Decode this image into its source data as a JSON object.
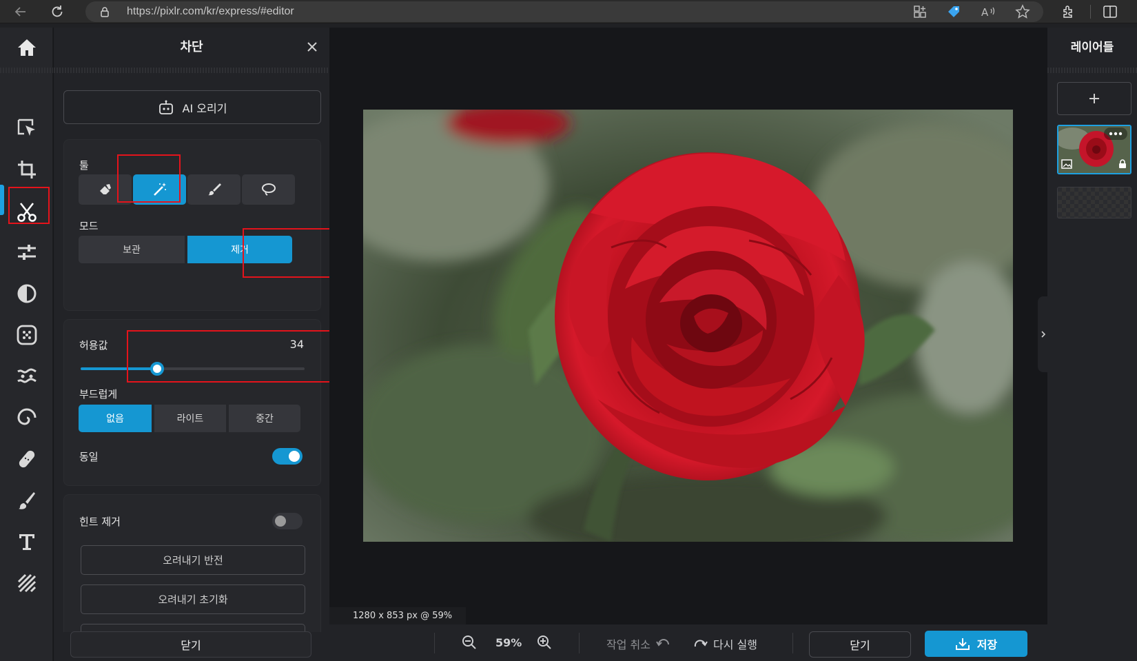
{
  "browser": {
    "url": "https://pixlr.com/kr/express/#editor"
  },
  "panel": {
    "title": "차단",
    "ai_button_label": "AI 오리기",
    "tools_label": "툴",
    "mode_label": "모드",
    "mode_options": [
      "보관",
      "제거"
    ],
    "mode_selected": "제거",
    "tolerance_label": "허용값",
    "tolerance_value": "34",
    "tolerance_fraction": 0.34,
    "smooth_label": "부드럽게",
    "smooth_options": [
      "없음",
      "라이트",
      "중간"
    ],
    "smooth_selected": "없음",
    "contiguous_label": "동일",
    "contiguous_on": true,
    "hint_label": "힌트 제거",
    "hint_on": false,
    "invert_button": "오려내기 반전",
    "reset_button": "오려내기 초기화",
    "close_button": "닫기"
  },
  "canvas": {
    "info": "1280 x 853 px @ 59%"
  },
  "bottombar": {
    "zoom": "59%",
    "undo_label": "작업 취소",
    "redo_label": "다시 실행",
    "close_label": "닫기",
    "save_label": "저장"
  },
  "layers": {
    "title": "레이어들"
  },
  "colors": {
    "accent": "#1597d2",
    "highlight_box": "#e5131b"
  }
}
